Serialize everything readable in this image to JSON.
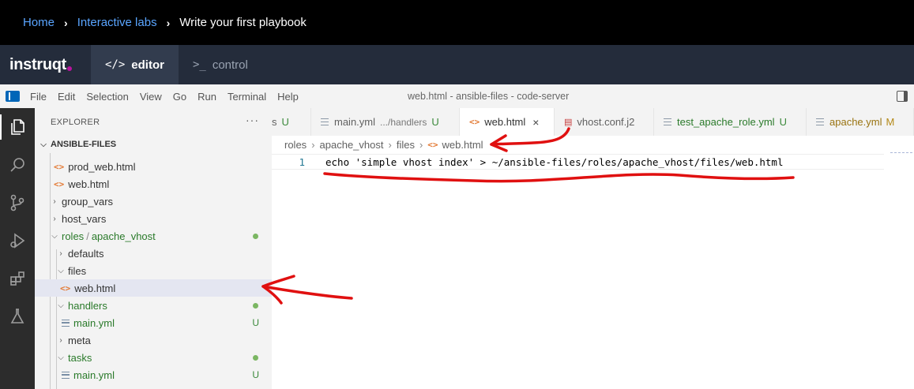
{
  "breadcrumb": {
    "home": "Home",
    "labs": "Interactive labs",
    "current": "Write your first playbook"
  },
  "instruqt": {
    "logo": "instruqt",
    "tabs": [
      {
        "icon": "</>",
        "label": "editor"
      },
      {
        "icon": ">_",
        "label": "control"
      }
    ]
  },
  "menubar": {
    "items": [
      "File",
      "Edit",
      "Selection",
      "View",
      "Go",
      "Run",
      "Terminal",
      "Help"
    ],
    "window_title": "web.html - ansible-files - code-server"
  },
  "explorer": {
    "title": "EXPLORER",
    "more": "···",
    "root": "ANSIBLE-FILES",
    "rows": [
      {
        "label": "prod_web.html"
      },
      {
        "label": "web.html"
      },
      {
        "label": "group_vars"
      },
      {
        "label": "host_vars"
      },
      {
        "label": "roles",
        "label2": "apache_vhost"
      },
      {
        "label": "defaults"
      },
      {
        "label": "files"
      },
      {
        "label": "web.html"
      },
      {
        "label": "handlers"
      },
      {
        "label": "main.yml",
        "badge": "U"
      },
      {
        "label": "meta"
      },
      {
        "label": "tasks"
      },
      {
        "label": "main.yml",
        "badge": "U"
      }
    ]
  },
  "tabs": [
    {
      "label": "s",
      "badge": "U"
    },
    {
      "label": "main.yml",
      "desc": ".../handlers",
      "badge": "U"
    },
    {
      "label": "web.html",
      "close": "×"
    },
    {
      "label": "vhost.conf.j2"
    },
    {
      "label": "test_apache_role.yml",
      "badge": "U"
    },
    {
      "label": "apache.yml",
      "badge": "M"
    }
  ],
  "crumbs": [
    "roles",
    "apache_vhost",
    "files",
    "web.html"
  ],
  "editor": {
    "line_number": "1",
    "code": "echo 'simple vhost index' > ~/ansible-files/roles/apache_vhost/files/web.html"
  },
  "colors": {
    "annotation_red": "#e01010",
    "link_blue": "#5aa5ff",
    "instruqt_bar": "#242c3b"
  }
}
